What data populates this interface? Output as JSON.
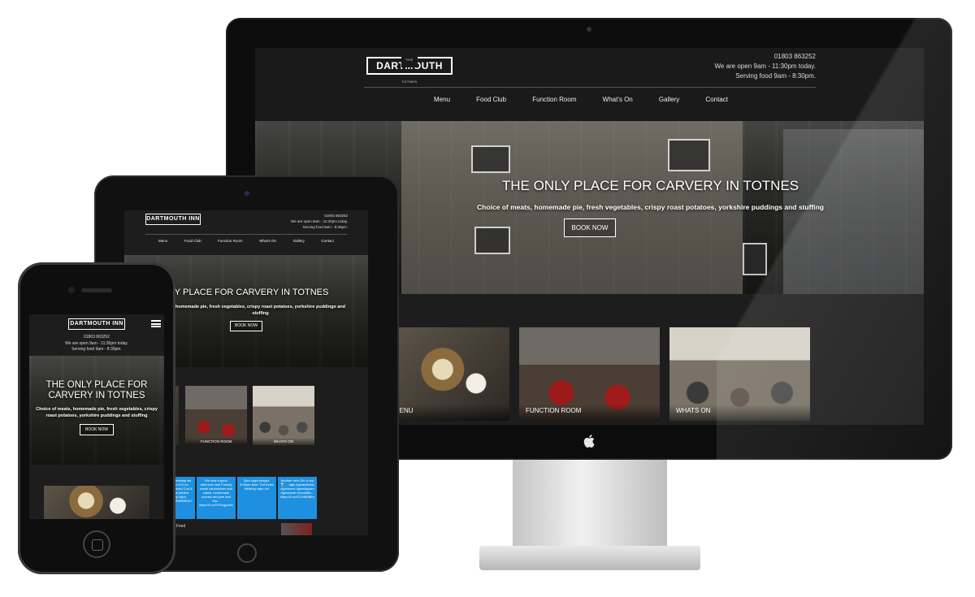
{
  "site": {
    "logo": {
      "top_word": "THE",
      "name": "DARTMOUTH INN",
      "bottom_word": "TOTNES"
    },
    "contact": {
      "phone": "01803 863252",
      "open": "We are open 9am - 11:30pm today.",
      "food": "Serving food 9am - 8:30pm."
    },
    "nav": [
      "Menu",
      "Food Club",
      "Function Room",
      "What's On",
      "Gallery",
      "Contact"
    ],
    "hero": {
      "title": "THE ONLY PLACE FOR CARVERY IN TOTNES",
      "subtitle": "Choice of meats, homemade pie, fresh vegetables, crispy roast potatoes, yorkshire puddings and stuffing",
      "button": "BOOK NOW"
    },
    "tiles": [
      "MENU",
      "FUNCTION ROOM",
      "WHATS ON"
    ]
  },
  "tablet": {
    "hero_title_visible": "ONLY PLACE FOR CARVERY IN TOTNES",
    "hero_sub_visible": "homemade pie, fresh vegetables, crispy roast potatoes, yorkshire puddings and stuffing",
    "tweets": [
      "",
      "Every Wednesday we have 2 for £10 on Freshly Battered Cod & Chips. The perfect Thursday night. https://t.co/JNN94ftUb7",
      "We love a good afternoon tea! Freshly made sandwiches and cakes, homemade scones and jam and tea... https://t.co/GHVqypcnD",
      "Quiz night tonight, 8:30pm start. Get those thinking caps on!",
      "Another new Gin to try! 🍸 ... #gin #ginandtonic #ginlovers #ginstagram #ginoclock #cocktails... https://t.co/tCC4MHlBm"
    ],
    "news_feed": "News Feed"
  },
  "phone": {
    "hero_title": "THE ONLY PLACE FOR CARVERY IN TOTNES",
    "hero_sub": "Choice of meats, homemade pie, fresh vegetables, crispy roast potatoes, yorkshire puddings and stuffing"
  }
}
